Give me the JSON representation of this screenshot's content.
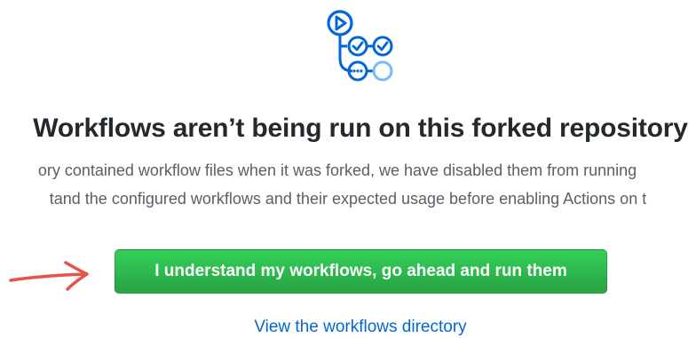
{
  "empty_state": {
    "title": "Workflows aren’t being run on this forked repository",
    "description_line_1": "ory contained workflow files when it was forked, we have disabled them from running",
    "description_line_2": "tand the configured workflows and their expected usage before enabling Actions on t",
    "primary_button": "I understand my workflows, go ahead and run them",
    "secondary_link": "View the workflows directory"
  },
  "icons": {
    "illustration": "workflow-run-icon",
    "annotation": "red-arrow-icon"
  },
  "colors": {
    "button_green": "#2ea44f",
    "link_blue": "#0366d6",
    "illustration_blue": "#0366d6",
    "arrow_red": "#e5534b",
    "title_text": "#24292e",
    "body_text": "#586069"
  }
}
